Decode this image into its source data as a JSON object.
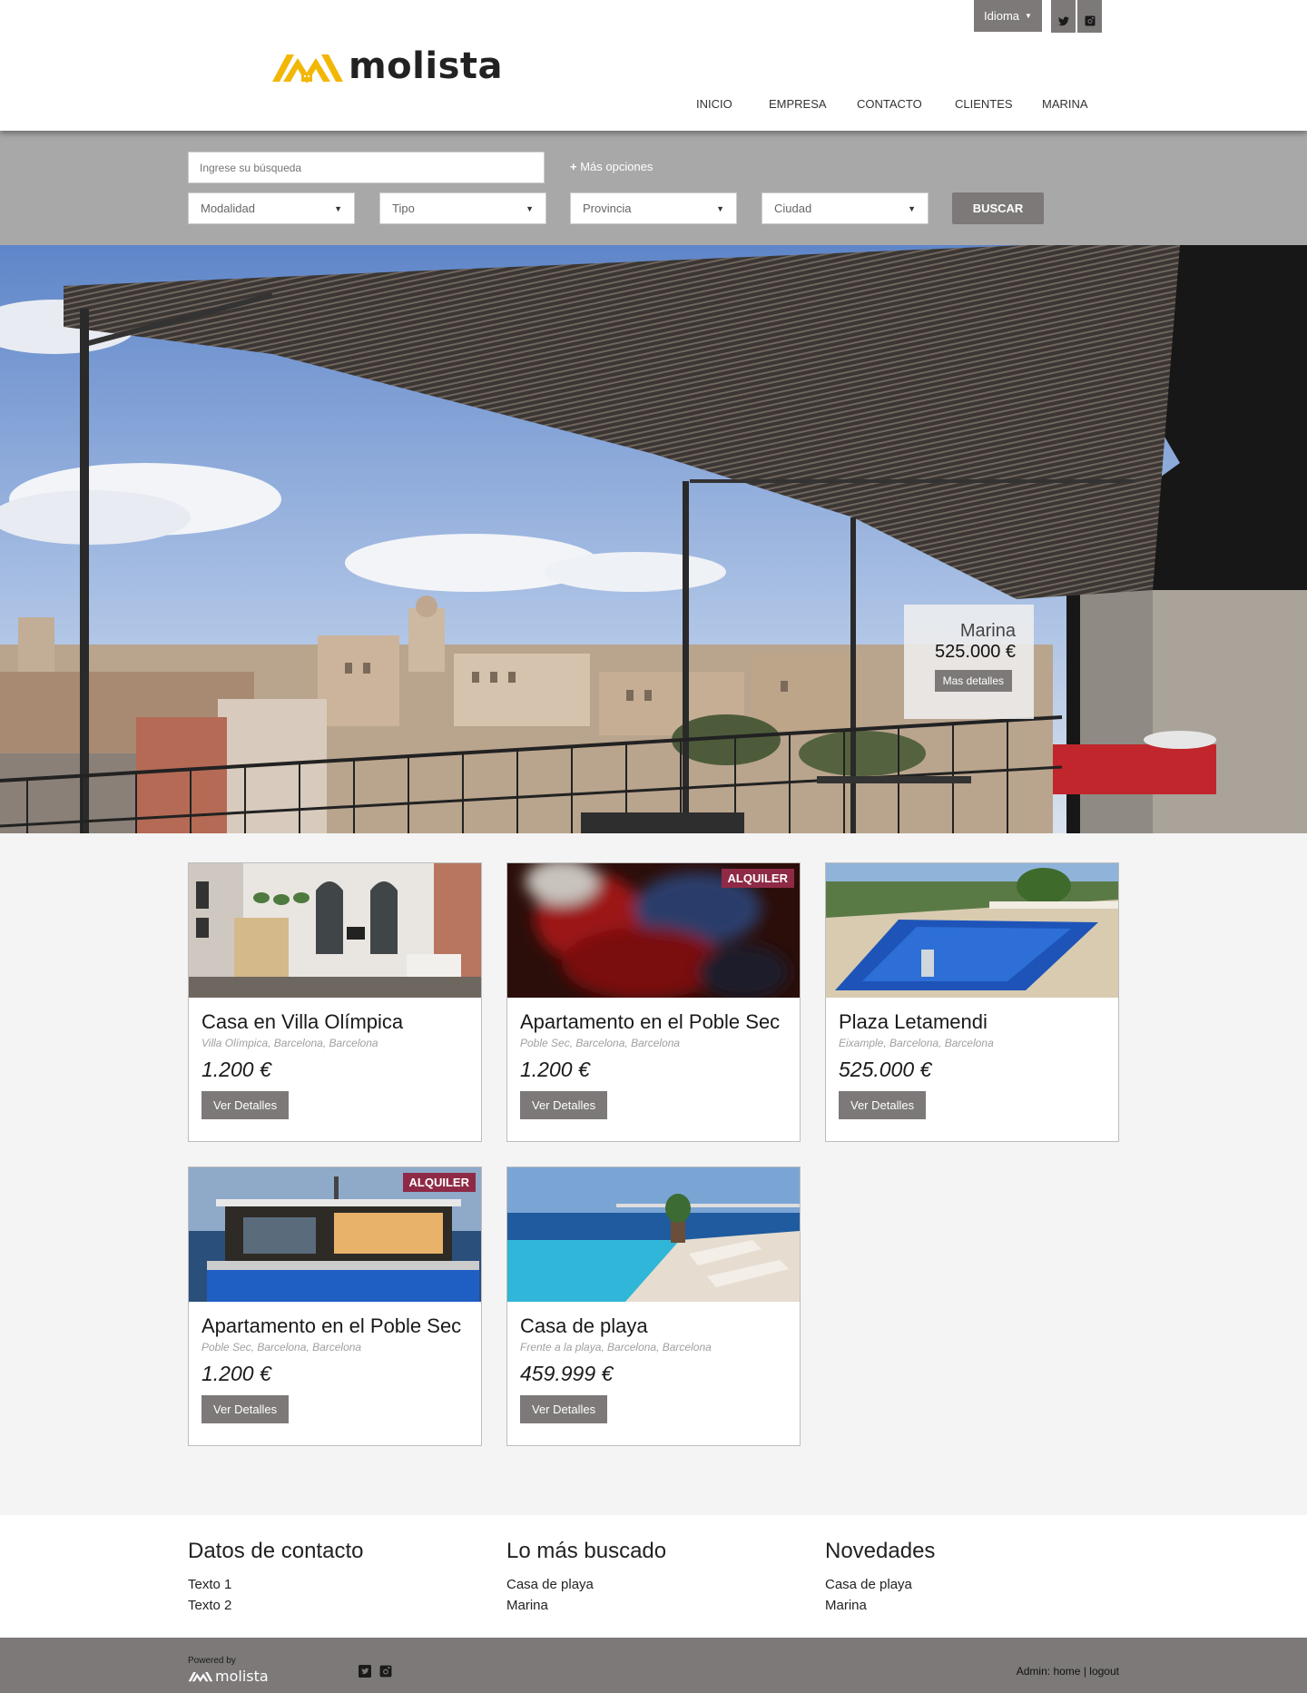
{
  "header": {
    "logo_text": "molista",
    "language_label": "Idioma",
    "nav": [
      "INICIO",
      "EMPRESA",
      "CONTACTO",
      "CLIENTES",
      "MARINA"
    ]
  },
  "search": {
    "placeholder": "Ingrese su búsqueda",
    "more_options": "Más opciones",
    "selects": [
      "Modalidad",
      "Tipo",
      "Provincia",
      "Ciudad"
    ],
    "submit_label": "BUSCAR"
  },
  "hero": {
    "title": "Marina",
    "price": "525.000 €",
    "button_label": "Mas detalles"
  },
  "listings": [
    {
      "title": "Casa en Villa Olímpica",
      "location": "Villa Olímpica, Barcelona, Barcelona",
      "price": "1.200 €",
      "badge": "",
      "button_label": "Ver Detalles"
    },
    {
      "title": "Apartamento en el Poble Sec",
      "location": "Poble Sec, Barcelona, Barcelona",
      "price": "1.200 €",
      "badge": "ALQUILER",
      "button_label": "Ver Detalles"
    },
    {
      "title": "Plaza Letamendi",
      "location": "Eixample, Barcelona, Barcelona",
      "price": "525.000 €",
      "badge": "",
      "button_label": "Ver Detalles"
    },
    {
      "title": "Apartamento en el Poble Sec",
      "location": "Poble Sec, Barcelona, Barcelona",
      "price": "1.200 €",
      "badge": "ALQUILER",
      "button_label": "Ver Detalles"
    },
    {
      "title": "Casa de playa",
      "location": "Frente a la playa, Barcelona, Barcelona",
      "price": "459.999 €",
      "badge": "",
      "button_label": "Ver Detalles"
    }
  ],
  "footer": {
    "columns": [
      {
        "title": "Datos de contacto",
        "items": [
          "Texto 1",
          "Texto 2"
        ]
      },
      {
        "title": "Lo más buscado",
        "items": [
          "Casa de playa",
          "Marina"
        ]
      },
      {
        "title": "Novedades",
        "items": [
          "Casa de playa",
          "Marina"
        ]
      }
    ],
    "powered_by": "Powered by",
    "powered_logo": "molista",
    "admin_label": "Admin:",
    "home_link": "home",
    "separator": "|",
    "logout_link": "logout"
  },
  "colors": {
    "accent_gray": "#7d7979",
    "search_band": "#a8a8a8",
    "badge": "#8e2a46",
    "logo_yellow": "#f2b705"
  },
  "icons": [
    "twitter-icon",
    "instagram-icon",
    "plus-icon",
    "caret-down-icon"
  ]
}
